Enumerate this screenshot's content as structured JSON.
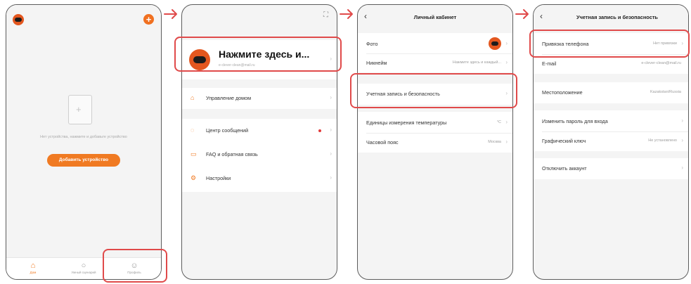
{
  "screen1": {
    "empty_text": "Нет устройства, нажмите и добавьте устройство",
    "add_button": "Добавить устройство",
    "tabs": [
      {
        "label": "Дом",
        "icon": "home-icon",
        "glyph": "⌂"
      },
      {
        "label": "Умный сценарий",
        "icon": "scene-icon",
        "glyph": "○"
      },
      {
        "label": "Профиль",
        "icon": "profile-icon",
        "glyph": "☺"
      }
    ]
  },
  "screen2": {
    "profile_name": "Нажмите здесь и...",
    "profile_email": "e-clever-clean@mail.ru",
    "menu": [
      {
        "label": "Управление домом",
        "icon": "home-outline-icon",
        "glyph": "⌂"
      },
      {
        "label": "Центр сообщений",
        "icon": "message-icon",
        "glyph": "◌"
      },
      {
        "label": "FAQ и обратная связь",
        "icon": "faq-icon",
        "glyph": "▭"
      },
      {
        "label": "Настройки",
        "icon": "settings-icon",
        "glyph": "⚙"
      }
    ]
  },
  "screen3": {
    "title": "Личный кабинет",
    "rows": [
      {
        "label": "Фото",
        "value": ""
      },
      {
        "label": "Никнейм",
        "value": "Нажмите здесь и каждый..."
      },
      {
        "label": "Учетная запись и безопасность",
        "value": ""
      },
      {
        "label": "Единицы измерения температуры",
        "value": "°C"
      },
      {
        "label": "Часовой пояс",
        "value": "Москва"
      }
    ]
  },
  "screen4": {
    "title": "Учетная запись и безопасность",
    "rows": [
      {
        "label": "Привязка телефона",
        "value": "Нет привязки"
      },
      {
        "label": "E-mail",
        "value": "e-clever-clean@mail.ru"
      },
      {
        "label": "Местоположение",
        "value": "Kazakstan/Russia"
      },
      {
        "label": "Изменить пароль для входа",
        "value": ""
      },
      {
        "label": "Графический ключ",
        "value": "Не установлено"
      },
      {
        "label": "Отключить аккаунт",
        "value": ""
      }
    ]
  },
  "colors": {
    "accent": "#f07a22",
    "highlight": "#e04a4a",
    "badge": "#e23a3a"
  }
}
